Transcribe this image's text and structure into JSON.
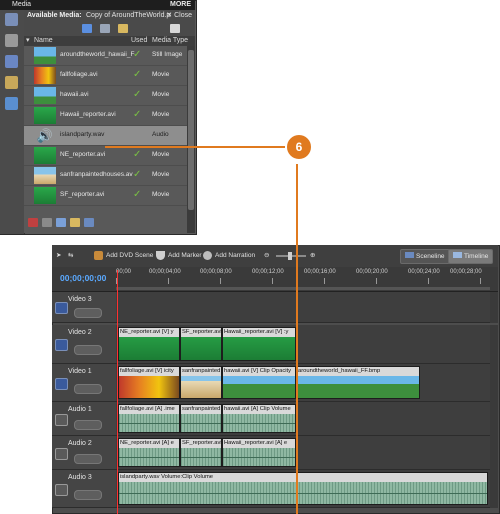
{
  "media_panel": {
    "title": "Media",
    "more": "MORE",
    "available_media": "Available Media:",
    "project_name": "Copy of AroundTheWorld.prel",
    "close": "Close",
    "columns": {
      "name": "Name",
      "used": "Used",
      "type": "Media Type"
    },
    "items": [
      {
        "name": "aroundtheworld_hawaii_F",
        "used": "✓",
        "type": "Still Image",
        "thumb": "th-sky"
      },
      {
        "name": "fallfoliage.avi",
        "used": "✓",
        "type": "Movie",
        "thumb": "th-fall"
      },
      {
        "name": "hawaii.avi",
        "used": "✓",
        "type": "Movie",
        "thumb": "th-sky"
      },
      {
        "name": "Hawaii_reporter.avi",
        "used": "✓",
        "type": "Movie",
        "thumb": "th-green"
      },
      {
        "name": "islandparty.wav",
        "used": "",
        "type": "Audio",
        "thumb": "speaker"
      },
      {
        "name": "NE_reporter.avi",
        "used": "✓",
        "type": "Movie",
        "thumb": "th-green"
      },
      {
        "name": "sanfranpaintedhouses.av",
        "used": "✓",
        "type": "Movie",
        "thumb": "th-houses"
      },
      {
        "name": "SF_reporter.avi",
        "used": "✓",
        "type": "Movie",
        "thumb": "th-green"
      }
    ]
  },
  "timeline": {
    "toolbar": {
      "add_dvd_scene": "Add DVD Scene",
      "add_marker": "Add Marker",
      "add_narration": "Add Narration",
      "sceneline": "Sceneline",
      "timeline": "Timeline"
    },
    "timecode": "00;00;00;00",
    "ruler_ticks": [
      "00;00",
      "00;00;04;00",
      "00;00;08;00",
      "00;00;12;00",
      "00;00;16;00",
      "00;00;20;00",
      "00;00;24;00",
      "00;00;28;00"
    ],
    "tracks": [
      {
        "name": "Video 3",
        "kind": "video",
        "clips": []
      },
      {
        "name": "Video 2",
        "kind": "video",
        "clips": [
          {
            "label": "NE_reporter.avi [V]  y",
            "style": "green"
          },
          {
            "label": "SF_reporter.avi [V]",
            "style": "green"
          },
          {
            "label": "Hawaii_reporter.avi [V]  :y",
            "style": "green"
          }
        ]
      },
      {
        "name": "Video 1",
        "kind": "video",
        "clips": [
          {
            "label": "fallfoliage.avi [V]  icity",
            "style": "fall"
          },
          {
            "label": "sanfranpainted",
            "style": "houses"
          },
          {
            "label": "hawaii.avi [V]  Clip Opacity",
            "style": "sky"
          },
          {
            "label": "aroundtheworld_hawaii_FF.bmp",
            "style": "sky"
          }
        ]
      },
      {
        "name": "Audio 1",
        "kind": "audio",
        "clips": [
          {
            "label": "fallfoliage.avi [A]  .ime"
          },
          {
            "label": "sanfranpainted"
          },
          {
            "label": "hawaii.avi [A]  Clip Volume"
          }
        ]
      },
      {
        "name": "Audio 2",
        "kind": "audio",
        "clips": [
          {
            "label": "NE_reporter.avi [A]  e"
          },
          {
            "label": "SF_reporter.avi [A]"
          },
          {
            "label": "Hawaii_reporter.avi [A]  e"
          }
        ]
      },
      {
        "name": "Audio 3",
        "kind": "audio",
        "clips": [
          {
            "label": "islandparty.wav  Volume:Clip Volume"
          }
        ]
      }
    ]
  },
  "callout": {
    "number": "6"
  },
  "colors": {
    "accent_orange": "#e07a1f",
    "timecode_blue": "#5aa9ff",
    "check_green": "#7ac142"
  }
}
